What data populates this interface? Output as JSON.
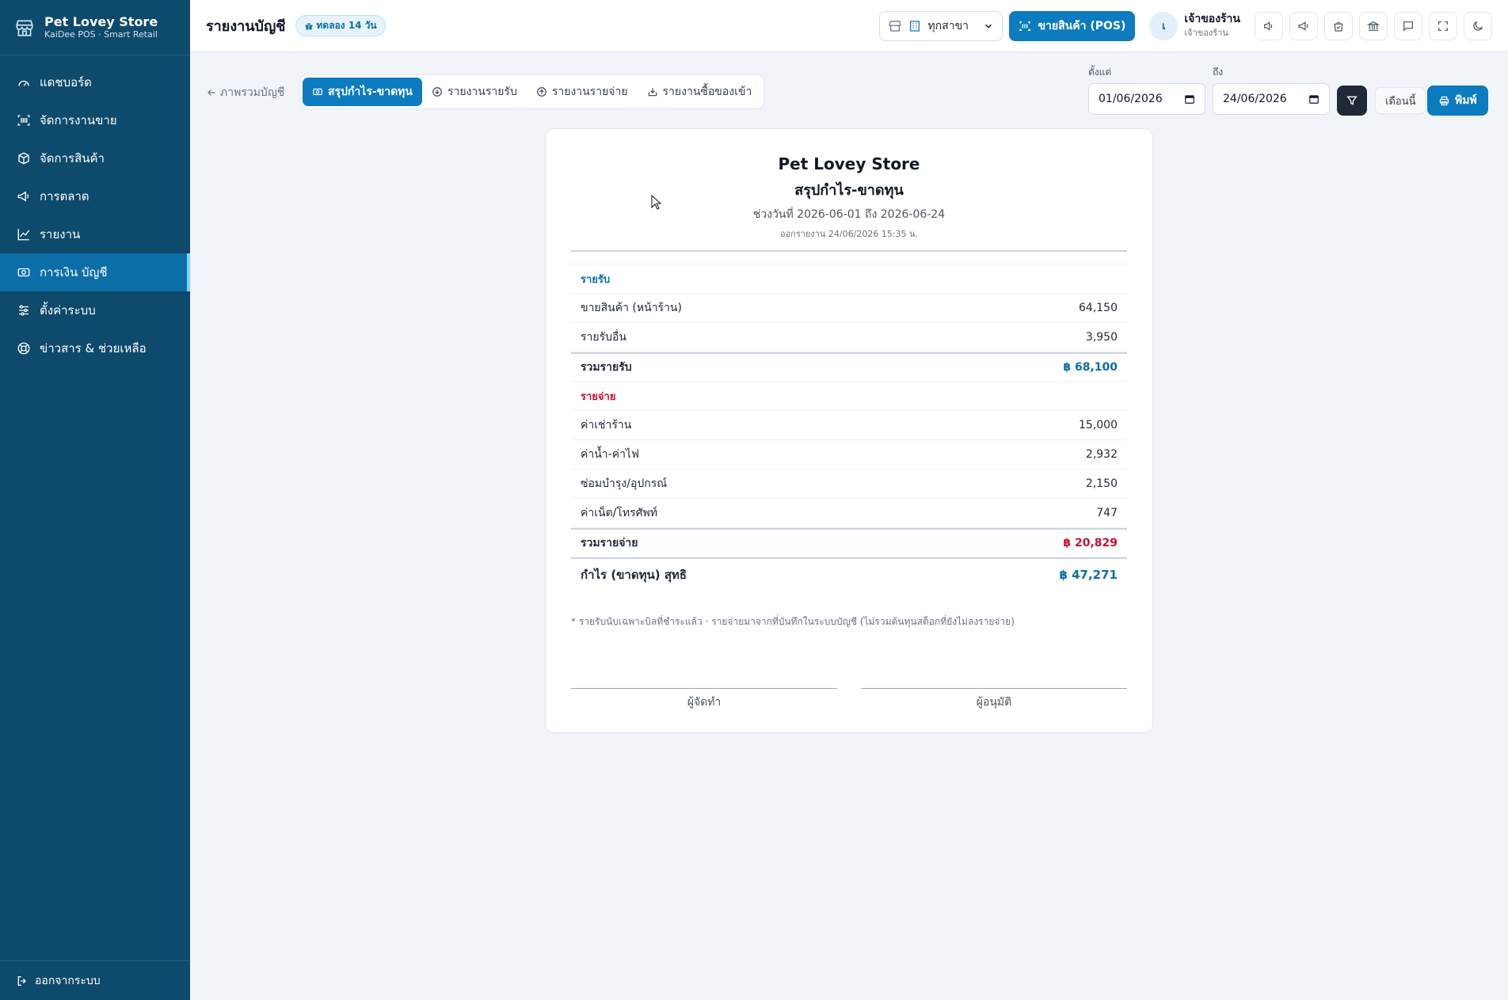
{
  "brand": {
    "name": "Pet Lovey Store",
    "subtitle": "KaiDee POS · Smart Retail"
  },
  "sidebar": {
    "items": [
      {
        "label": "แดชบอร์ด",
        "icon": "dashboard-icon"
      },
      {
        "label": "จัดการงานขาย",
        "icon": "barcode-scan-icon"
      },
      {
        "label": "จัดการสินค้า",
        "icon": "box-icon"
      },
      {
        "label": "การตลาด",
        "icon": "megaphone-icon"
      },
      {
        "label": "รายงาน",
        "icon": "chart-line-icon"
      },
      {
        "label": "การเงิน บัญชี",
        "icon": "money-icon"
      },
      {
        "label": "ตั้งค่าระบบ",
        "icon": "sliders-icon"
      },
      {
        "label": "ข่าวสาร & ช่วยเหลือ",
        "icon": "lifebuoy-icon"
      }
    ],
    "active_index": 5,
    "logout_label": "ออกจากระบบ"
  },
  "header": {
    "title": "รายงานบัญชี",
    "trial_badge": "ทดลอง 14 วัน",
    "branch_select": "ทุกสาขา",
    "pos_button": "ขายสินค้า (POS)",
    "user": {
      "initial": "เ",
      "name": "เจ้าของร้าน",
      "role": "เจ้าของร้าน"
    },
    "icons": [
      "speaker-icon",
      "megaphone-icon",
      "bag-check-icon",
      "bank-icon",
      "chat-icon",
      "fullscreen-icon",
      "moon-icon"
    ]
  },
  "toolbar": {
    "back_label": "ภาพรวมบัญชี",
    "tabs": [
      {
        "label": "สรุปกำไร-ขาดทุน",
        "icon": "cash-icon",
        "active": true
      },
      {
        "label": "รายงานรายรับ",
        "icon": "arrow-down-circle-icon",
        "active": false
      },
      {
        "label": "รายงานรายจ่าย",
        "icon": "arrow-up-circle-icon",
        "active": false
      },
      {
        "label": "รายงานซื้อของเข้า",
        "icon": "inbox-icon",
        "active": false
      }
    ],
    "from_label": "ตั้งแต่",
    "from_value": "01/06/2026",
    "to_label": "ถึง",
    "to_value": "24/06/2026",
    "month_button": "เดือนนี้",
    "print_button": "พิมพ์"
  },
  "report": {
    "store": "Pet Lovey Store",
    "title": "สรุปกำไร-ขาดทุน",
    "range": "ช่วงวันที่ 2026-06-01 ถึง 2026-06-24",
    "issued": "ออกรายงาน 24/06/2026 15:35 น.",
    "income_header": "รายรับ",
    "income": [
      {
        "label": "ขายสินค้า (หน้าร้าน)",
        "amount": "64,150"
      },
      {
        "label": "รายรับอื่น",
        "amount": "3,950"
      }
    ],
    "income_total_label": "รวมรายรับ",
    "income_total": "฿ 68,100",
    "expense_header": "รายจ่าย",
    "expenses": [
      {
        "label": "ค่าเช่าร้าน",
        "amount": "15,000"
      },
      {
        "label": "ค่าน้ำ-ค่าไฟ",
        "amount": "2,932"
      },
      {
        "label": "ซ่อมบำรุง/อุปกรณ์",
        "amount": "2,150"
      },
      {
        "label": "ค่าเน็ต/โทรศัพท์",
        "amount": "747"
      }
    ],
    "expense_total_label": "รวมรายจ่าย",
    "expense_total": "฿ 20,829",
    "net_label": "กำไร (ขาดทุน) สุทธิ",
    "net_total": "฿ 47,271",
    "note": "* รายรับนับเฉพาะบิลที่ชำระแล้ว · รายจ่ายมาจากที่บันทึกในระบบบัญชี (ไม่รวมต้นทุนสต็อกที่ยังไม่ลงรายจ่าย)",
    "sign_prepared": "ผู้จัดทำ",
    "sign_approved": "ผู้อนุมัติ"
  },
  "colors": {
    "sidebar": "#0e4a6b",
    "accent": "#0c7bc0",
    "income": "#0c6ea6",
    "expense": "#c8102e"
  }
}
